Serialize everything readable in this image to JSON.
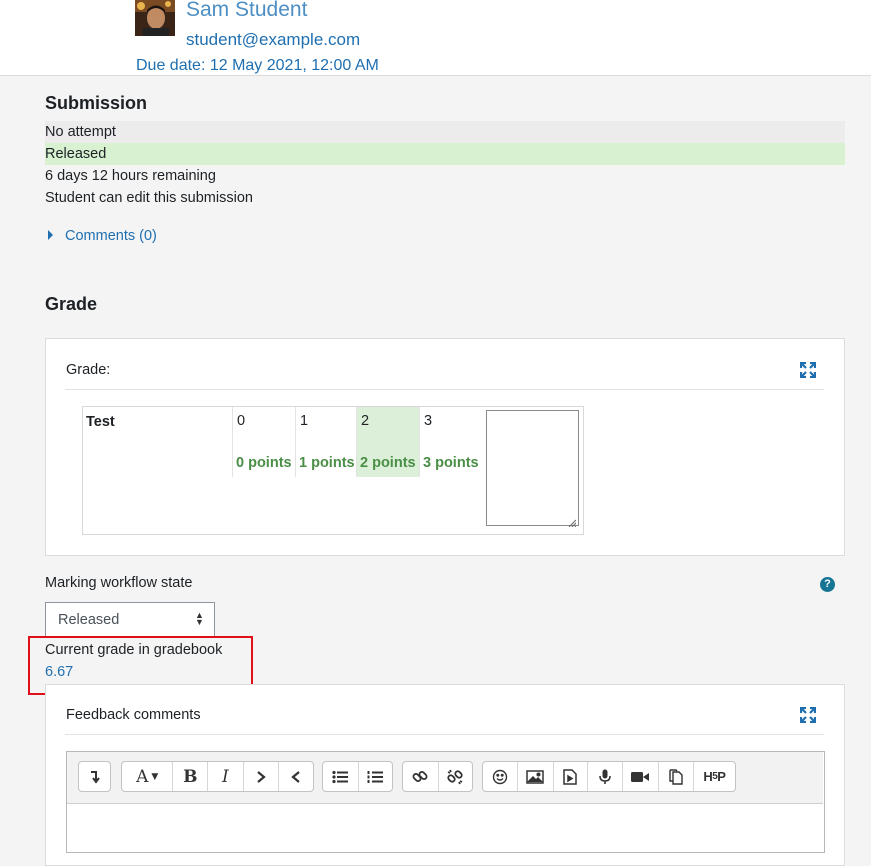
{
  "user": {
    "name": "Sam Student",
    "email": "student@example.com",
    "due_date": "Due date: 12 May 2021, 12:00 AM"
  },
  "submission": {
    "title": "Submission",
    "rows": [
      "No attempt",
      "Released",
      "6 days 12 hours remaining",
      "Student can edit this submission"
    ],
    "comments_link": "Comments (0)"
  },
  "grade": {
    "title": "Grade",
    "field_label": "Grade:",
    "rubric": {
      "criterion": "Test",
      "levels": [
        {
          "score": "0",
          "definition": "0 points"
        },
        {
          "score": "1",
          "definition": "1 points"
        },
        {
          "score": "2",
          "definition": "2 points"
        },
        {
          "score": "3",
          "definition": "3 points"
        }
      ],
      "selected_level_index": 2
    }
  },
  "workflow": {
    "label": "Marking workflow state",
    "selected": "Released"
  },
  "gradebook": {
    "label": "Current grade in gradebook",
    "value": "6.67"
  },
  "feedback": {
    "label": "Feedback comments"
  },
  "colors": {
    "link": "#1f6fb0",
    "released_bg": "#d7f1d1",
    "highlight_border": "#e0101a",
    "points_text": "#4a8f45"
  },
  "toolbar_icons": [
    "collapse-icon",
    "font-color-icon",
    "bold-icon",
    "italic-icon",
    "indent-icon",
    "outdent-icon",
    "bullet-list-icon",
    "numbered-list-icon",
    "link-icon",
    "unlink-icon",
    "emoji-icon",
    "image-icon",
    "media-file-icon",
    "record-audio-icon",
    "record-video-icon",
    "manage-files-icon",
    "h5p-icon"
  ]
}
